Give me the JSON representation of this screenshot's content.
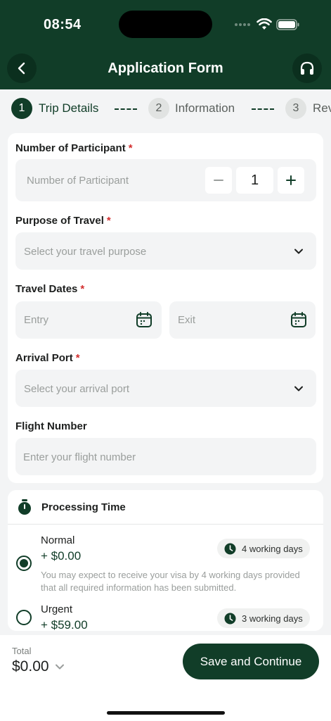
{
  "status_bar": {
    "time": "08:54"
  },
  "header": {
    "title": "Application Form"
  },
  "stepper": {
    "steps": [
      {
        "number": "1",
        "label": "Trip Details"
      },
      {
        "number": "2",
        "label": "Information"
      },
      {
        "number": "3",
        "label": "Rev"
      }
    ]
  },
  "form": {
    "participants": {
      "label": "Number of Participant",
      "required": "*",
      "placeholder": "Number of Participant",
      "value": "1"
    },
    "purpose": {
      "label": "Purpose of Travel",
      "required": "*",
      "placeholder": "Select your travel purpose"
    },
    "dates": {
      "label": "Travel Dates",
      "required": "*",
      "entry_placeholder": "Entry",
      "exit_placeholder": "Exit"
    },
    "arrival": {
      "label": "Arrival Port",
      "required": "*",
      "placeholder": "Select your arrival port"
    },
    "flight": {
      "label": "Flight Number",
      "placeholder": "Enter your flight number"
    }
  },
  "processing": {
    "title": "Processing Time",
    "options": [
      {
        "name": "Normal",
        "price": "+ $0.00",
        "badge": "4 working days",
        "description": "You may expect to receive your visa by 4 working days provided that all required information has been submitted.",
        "selected": true
      },
      {
        "name": "Urgent",
        "price": "+ $59.00",
        "badge": "3 working days",
        "selected": false
      }
    ]
  },
  "footer": {
    "total_label": "Total",
    "total_value": "$0.00",
    "button_label": "Save and Continue"
  },
  "colors": {
    "primary": "#113d28",
    "required": "#d32f2f",
    "background": "#f3f4f5"
  }
}
